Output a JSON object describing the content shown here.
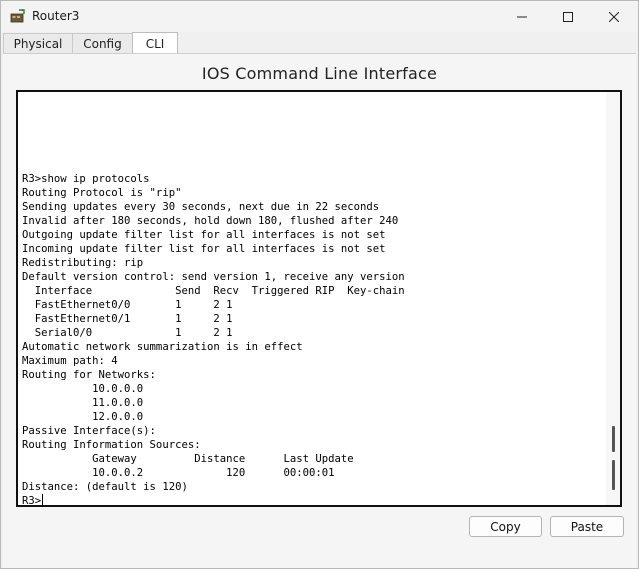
{
  "window": {
    "title": "Router3"
  },
  "tabs": [
    {
      "label": "Physical"
    },
    {
      "label": "Config"
    },
    {
      "label": "CLI"
    }
  ],
  "panel": {
    "title": "IOS Command Line Interface"
  },
  "terminal": {
    "lines": [
      "R3>show ip protocols",
      "Routing Protocol is \"rip\"",
      "Sending updates every 30 seconds, next due in 22 seconds",
      "Invalid after 180 seconds, hold down 180, flushed after 240",
      "Outgoing update filter list for all interfaces is not set",
      "Incoming update filter list for all interfaces is not set",
      "Redistributing: rip",
      "Default version control: send version 1, receive any version",
      "  Interface             Send  Recv  Triggered RIP  Key-chain",
      "  FastEthernet0/0       1     2 1",
      "  FastEthernet0/1       1     2 1",
      "  Serial0/0             1     2 1",
      "Automatic network summarization is in effect",
      "Maximum path: 4",
      "Routing for Networks:",
      "           10.0.0.0",
      "           11.0.0.0",
      "           12.0.0.0",
      "Passive Interface(s):",
      "Routing Information Sources:",
      "           Gateway         Distance      Last Update",
      "           10.0.0.2             120      00:00:01",
      "Distance: (default is 120)"
    ],
    "prompt": "R3>"
  },
  "buttons": {
    "copy": "Copy",
    "paste": "Paste"
  },
  "icons": {
    "app": "router-icon",
    "minimize": "minimize-icon",
    "maximize": "maximize-icon",
    "close": "close-icon"
  }
}
